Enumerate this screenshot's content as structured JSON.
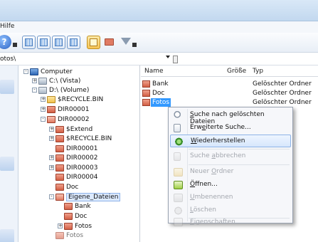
{
  "menubar": {
    "visible_text": "Hilfe"
  },
  "path": {
    "value": "otos\\"
  },
  "tree": {
    "nodes": [
      {
        "label": "Computer",
        "icon": "computer-icon",
        "exp": "-"
      },
      {
        "label": "C:\\ (Vista)",
        "icon": "drive-icon",
        "exp": "+"
      },
      {
        "label": "D:\\ (Volume)",
        "icon": "drive-icon",
        "exp": "-"
      },
      {
        "label": "$RECYCLE.BIN",
        "icon": "folder-yellow-icon",
        "exp": "+"
      },
      {
        "label": "DIR00001",
        "icon": "folder-red-icon",
        "exp": "+"
      },
      {
        "label": "DIR00002",
        "icon": "folder-red-open-icon",
        "exp": "-"
      },
      {
        "label": "$Extend",
        "icon": "folder-red-icon",
        "exp": "+"
      },
      {
        "label": "$RECYCLE.BIN",
        "icon": "folder-red-icon",
        "exp": "+"
      },
      {
        "label": "DIR00001",
        "icon": "folder-red-icon",
        "exp": ""
      },
      {
        "label": "DIR00002",
        "icon": "folder-red-icon",
        "exp": "+"
      },
      {
        "label": "DIR00003",
        "icon": "folder-red-icon",
        "exp": "+"
      },
      {
        "label": "DIR00004",
        "icon": "folder-red-icon",
        "exp": ""
      },
      {
        "label": "Doc",
        "icon": "folder-red-icon",
        "exp": ""
      },
      {
        "label": "Eigene_Dateien",
        "icon": "folder-red-open-icon",
        "exp": "-"
      },
      {
        "label": "Bank",
        "icon": "folder-red-icon",
        "exp": ""
      },
      {
        "label": "Doc",
        "icon": "folder-red-icon",
        "exp": ""
      },
      {
        "label": "Fotos",
        "icon": "folder-red-icon",
        "exp": "+"
      },
      {
        "label": "Fotos",
        "icon": "folder-red-icon",
        "exp": ""
      }
    ]
  },
  "list": {
    "columns": {
      "name": "Name",
      "size": "Größe",
      "type": "Typ"
    },
    "rows": [
      {
        "name": "Bank",
        "type": "Gelöschter Ordner"
      },
      {
        "name": "Doc",
        "type": "Gelöschter Ordner"
      },
      {
        "name": "Fotos",
        "type": "Gelöschter Ordner"
      }
    ]
  },
  "context_menu": {
    "items": [
      {
        "pre": "",
        "key": "S",
        "post": "uche nach gelöschten Dateien",
        "enabled": true
      },
      {
        "pre": "Erw",
        "key": "e",
        "post": "iterte Suche...",
        "enabled": true
      },
      {
        "pre": "",
        "key": "W",
        "post": "iederherstellen",
        "enabled": true,
        "highlighted": true
      },
      {
        "pre": "Suche ",
        "key": "a",
        "post": "bbrechen",
        "enabled": false
      },
      {
        "pre": "Neuer ",
        "key": "O",
        "post": "rdner",
        "enabled": false
      },
      {
        "pre": "",
        "key": "Ö",
        "post": "ffnen...",
        "enabled": true
      },
      {
        "pre": "",
        "key": "U",
        "post": "mbenennen",
        "enabled": false
      },
      {
        "pre": "",
        "key": "L",
        "post": "öschen",
        "enabled": false
      },
      {
        "pre": "",
        "key": "E",
        "post": "igenschaften",
        "enabled": false
      }
    ]
  }
}
